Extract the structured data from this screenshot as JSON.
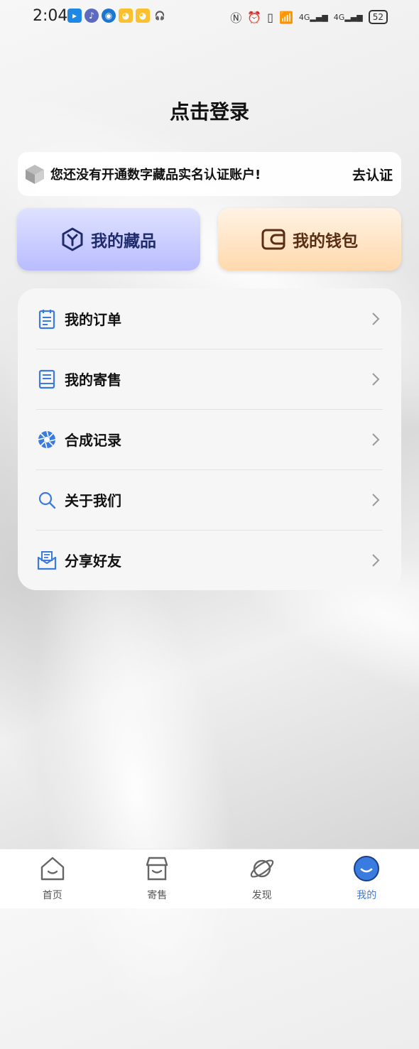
{
  "status_bar": {
    "time": "2:04",
    "battery": "52",
    "network_1": "4G",
    "network_2": "4G"
  },
  "header": {
    "login_title": "点击登录"
  },
  "notice": {
    "text": "您还没有开通数字藏品实名认证账户!",
    "link": "去认证"
  },
  "quick_actions": {
    "collection_label": "我的藏品",
    "wallet_label": "我的钱包"
  },
  "menu": {
    "items": [
      {
        "label": "我的订单",
        "icon": "order-icon"
      },
      {
        "label": "我的寄售",
        "icon": "consign-icon"
      },
      {
        "label": "合成记录",
        "icon": "synthesis-icon"
      },
      {
        "label": "关于我们",
        "icon": "search-icon"
      },
      {
        "label": "分享好友",
        "icon": "share-icon"
      }
    ]
  },
  "tabbar": {
    "items": [
      {
        "label": "首页",
        "icon": "home-icon"
      },
      {
        "label": "寄售",
        "icon": "store-icon"
      },
      {
        "label": "发现",
        "icon": "planet-icon"
      },
      {
        "label": "我的",
        "icon": "profile-icon",
        "active": true
      }
    ]
  },
  "colors": {
    "accent": "#3a7be0",
    "collection_bg": "#c9cbff",
    "wallet_bg": "#ffe3c2"
  }
}
